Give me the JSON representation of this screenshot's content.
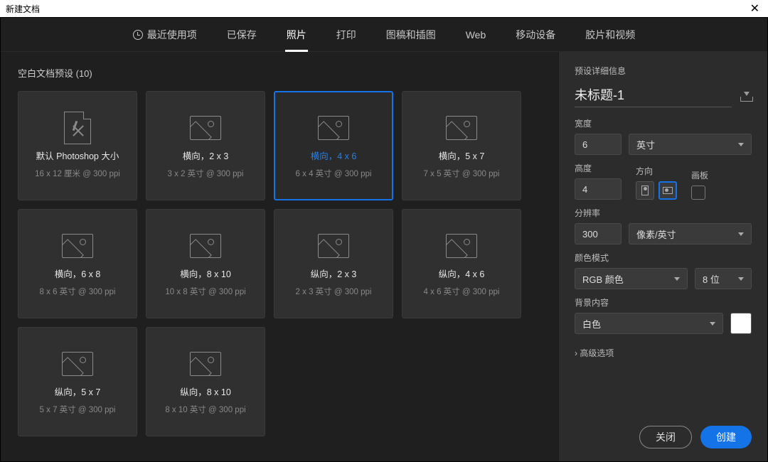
{
  "window": {
    "title": "新建文档"
  },
  "tabs": {
    "recent": "最近使用项",
    "saved": "已保存",
    "photo": "照片",
    "print": "打印",
    "art": "图稿和插图",
    "web": "Web",
    "mobile": "移动设备",
    "film": "胶片和视频"
  },
  "section": {
    "title": "空白文档预设 (10)"
  },
  "presets": [
    {
      "title": "默认 Photoshop 大小",
      "sub": "16 x 12 厘米 @ 300 ppi",
      "icon": "ps"
    },
    {
      "title": "横向，2 x 3",
      "sub": "3 x 2 英寸 @ 300 ppi",
      "icon": "img"
    },
    {
      "title": "横向，4 x 6",
      "sub": "6 x 4 英寸 @ 300 ppi",
      "icon": "img",
      "selected": true
    },
    {
      "title": "横向，5 x 7",
      "sub": "7 x 5 英寸 @ 300 ppi",
      "icon": "img"
    },
    {
      "title": "横向，6 x 8",
      "sub": "8 x 6 英寸 @ 300 ppi",
      "icon": "img"
    },
    {
      "title": "横向，8 x 10",
      "sub": "10 x 8 英寸 @ 300 ppi",
      "icon": "img"
    },
    {
      "title": "纵向，2 x 3",
      "sub": "2 x 3 英寸 @ 300 ppi",
      "icon": "img"
    },
    {
      "title": "纵向，4 x 6",
      "sub": "4 x 6 英寸 @ 300 ppi",
      "icon": "img"
    },
    {
      "title": "纵向，5 x 7",
      "sub": "5 x 7 英寸 @ 300 ppi",
      "icon": "img"
    },
    {
      "title": "纵向，8 x 10",
      "sub": "8 x 10 英寸 @ 300 ppi",
      "icon": "img"
    }
  ],
  "details": {
    "heading": "预设详细信息",
    "name": "未标题-1",
    "width_label": "宽度",
    "width_value": "6",
    "width_unit": "英寸",
    "height_label": "高度",
    "height_value": "4",
    "orientation_label": "方向",
    "artboard_label": "画板",
    "resolution_label": "分辨率",
    "resolution_value": "300",
    "resolution_unit": "像素/英寸",
    "color_mode_label": "颜色模式",
    "color_mode": "RGB 颜色",
    "color_depth": "8 位",
    "bg_label": "背景内容",
    "bg_value": "白色",
    "advanced": "高级选项"
  },
  "footer": {
    "close": "关闭",
    "create": "创建"
  }
}
